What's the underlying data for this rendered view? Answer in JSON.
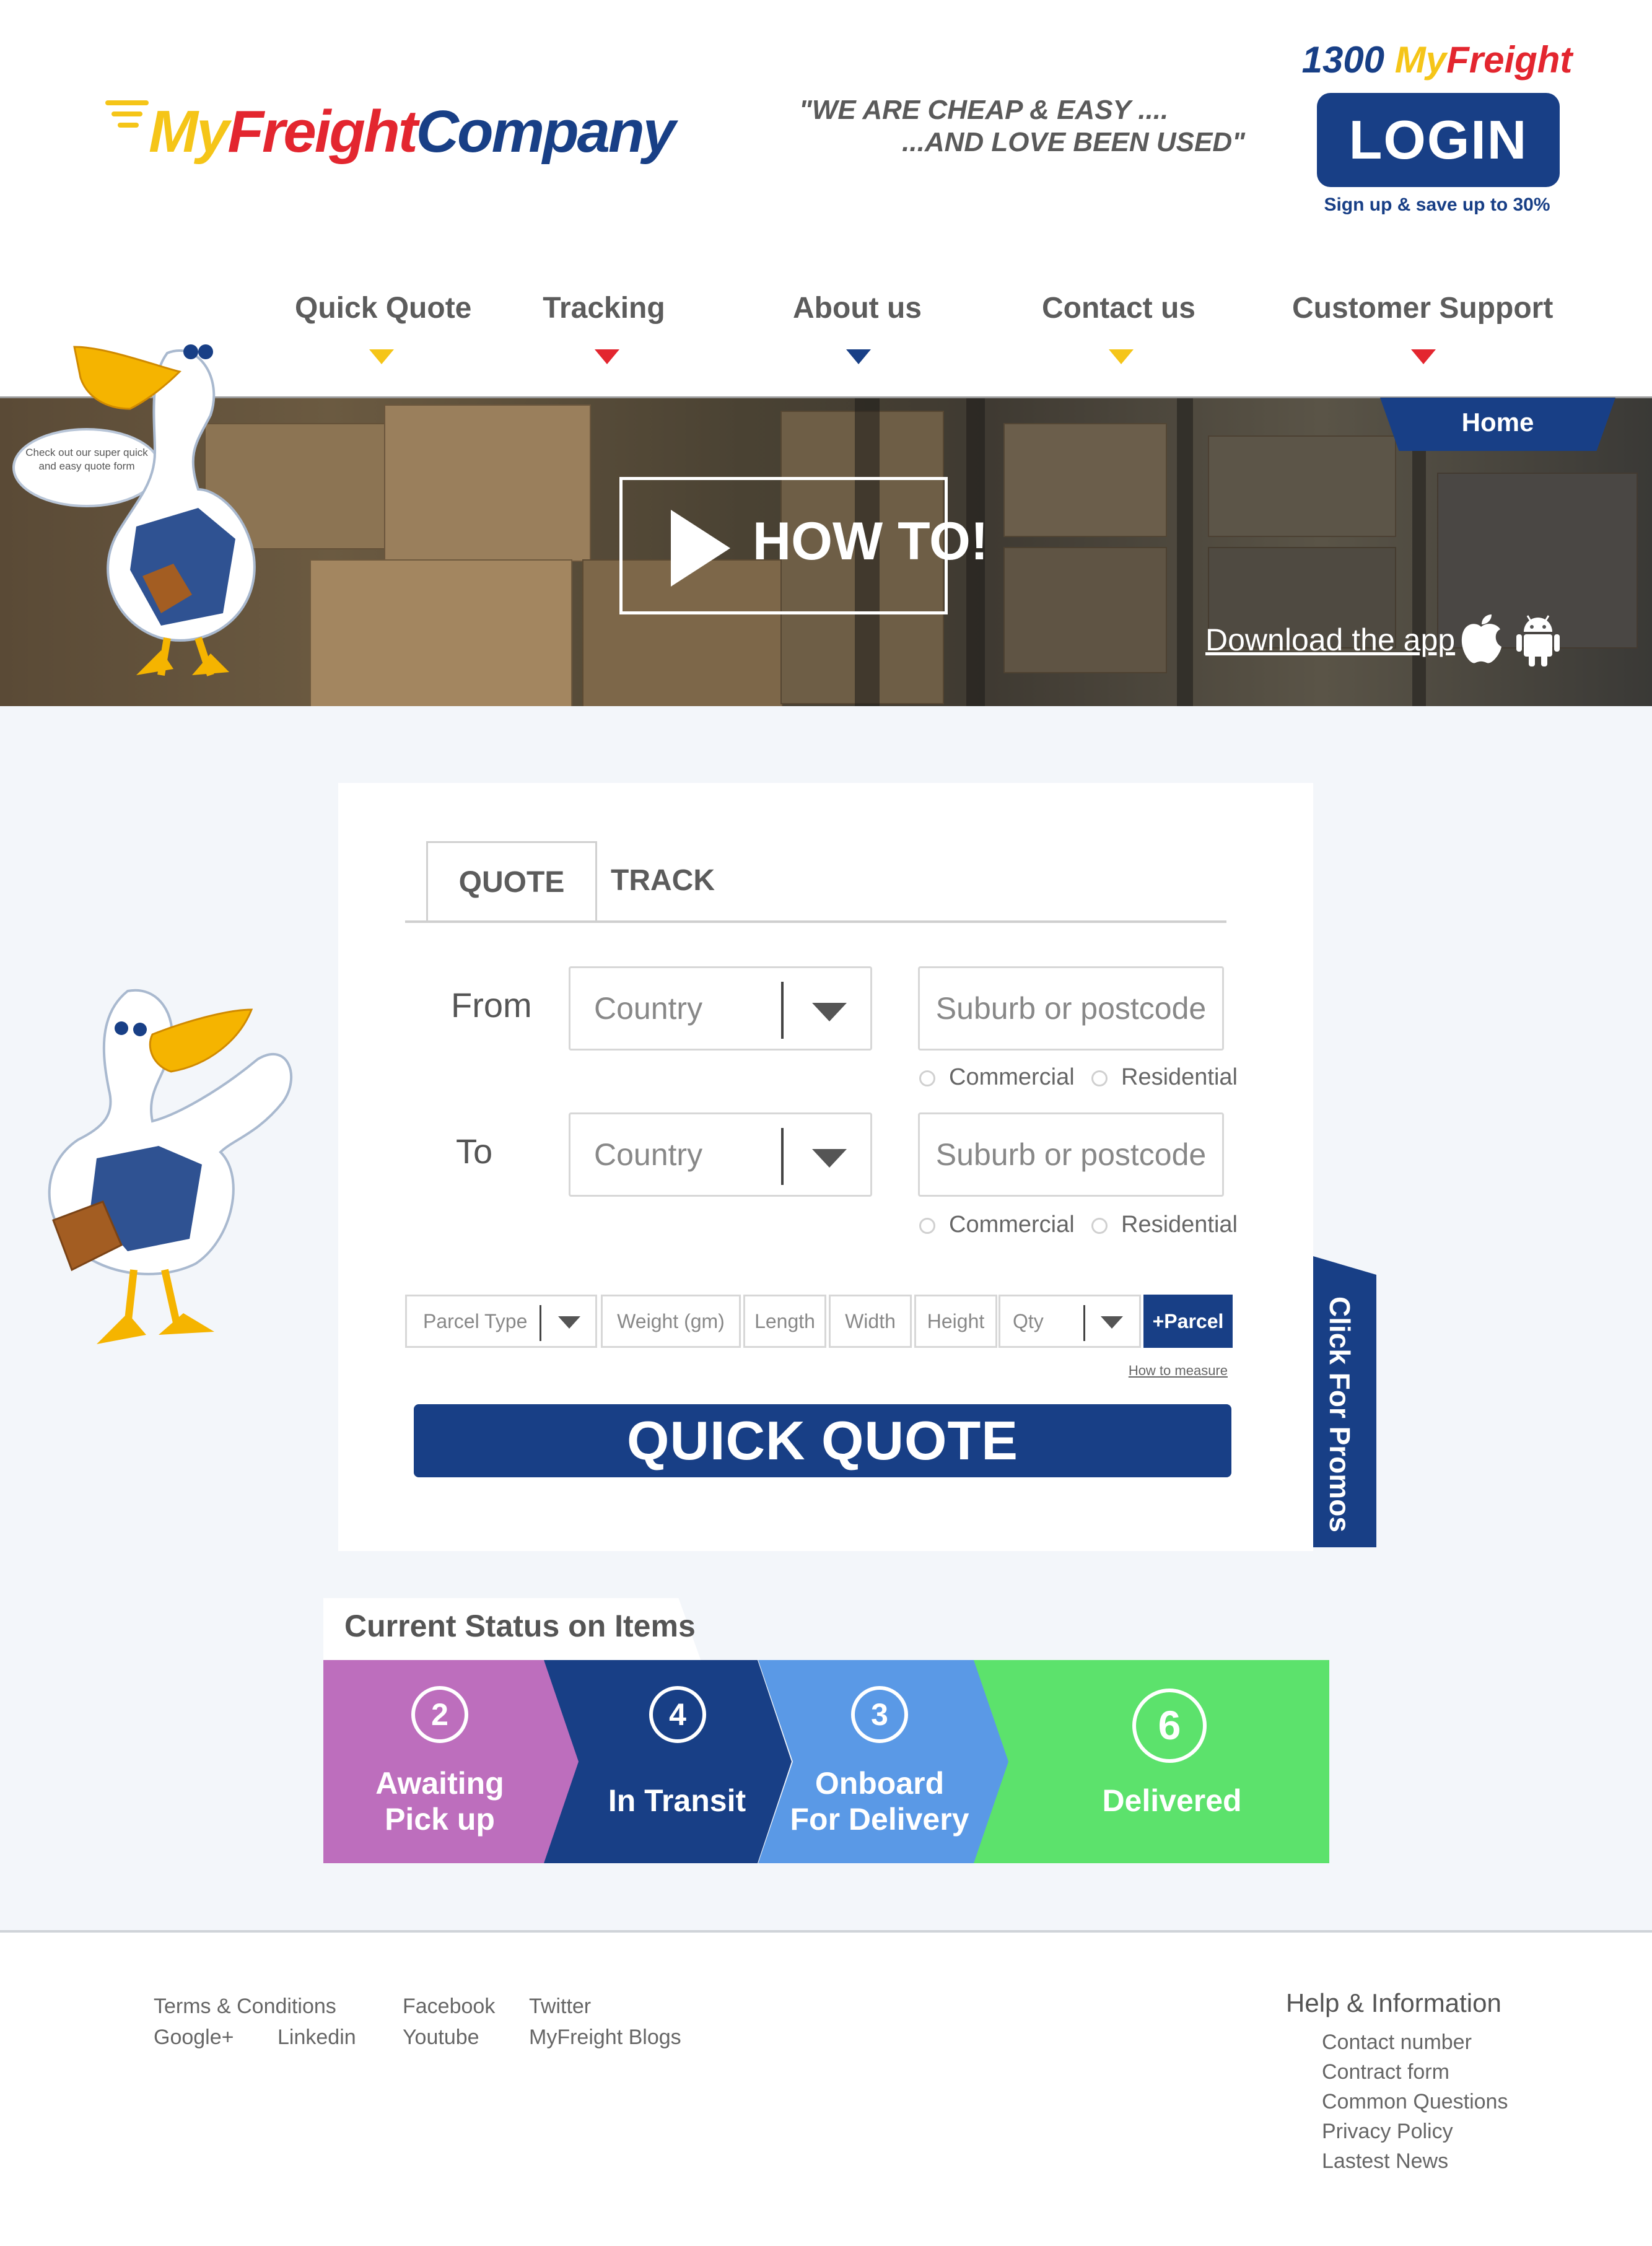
{
  "header": {
    "logo": {
      "my": "My",
      "freight": "Freight",
      "company": "Company"
    },
    "tagline_line1": "\"WE ARE CHEAP & EASY ....",
    "tagline_line2": "...AND LOVE BEEN USED\"",
    "phone_number": "1300",
    "phone_my": "My",
    "phone_freight": "Freight",
    "login_label": "LOGIN",
    "signup_text": "Sign up & save up to 30%"
  },
  "nav": {
    "items": [
      {
        "label": "Quick Quote",
        "color": "#f5c518"
      },
      {
        "label": "Tracking",
        "color": "#e3262f"
      },
      {
        "label": "About us",
        "color": "#183f86"
      },
      {
        "label": "Contact us",
        "color": "#f5c518"
      },
      {
        "label": "Customer Support",
        "color": "#e3262f"
      }
    ]
  },
  "banner": {
    "speech_bubble": "Check out our super quick and easy quote form",
    "home_tab": "Home",
    "howto_label": "HOW TO!",
    "download_label": "Download the app",
    "icons": [
      "apple-icon",
      "android-icon"
    ]
  },
  "form": {
    "tabs": [
      "QUOTE",
      "TRACK"
    ],
    "from_label": "From",
    "to_label": "To",
    "country_placeholder": "Country",
    "suburb_placeholder": "Suburb or postcode",
    "commercial_label": "Commercial",
    "residential_label": "Residential",
    "parcel": {
      "type": "Parcel Type",
      "weight": "Weight (gm)",
      "length": "Length",
      "width": "Width",
      "height": "Height",
      "qty": "Qty",
      "add_button": "+Parcel"
    },
    "how_to_measure": "How to measure",
    "quick_quote_button": "QUICK QUOTE",
    "promo_tab": "Click For Promos"
  },
  "status": {
    "title": "Current Status on Items",
    "steps": [
      {
        "count": "2",
        "line1": "Awaiting",
        "line2": "Pick up",
        "color": "#bd6ebd"
      },
      {
        "count": "4",
        "line1": "In Transit",
        "line2": "",
        "color": "#183f86"
      },
      {
        "count": "3",
        "line1": "Onboard",
        "line2": "For Delivery",
        "color": "#5a99e6"
      },
      {
        "count": "6",
        "line1": "Delivered",
        "line2": "",
        "color": "#5ce26c"
      }
    ]
  },
  "footer": {
    "links": [
      "Terms & Conditions",
      "Facebook",
      "Twitter",
      "Google+",
      "Linkedin",
      "Youtube",
      "MyFreight Blogs"
    ],
    "help_title": "Help & Information",
    "help_links": [
      "Contact number",
      "Contract form",
      "Common Questions",
      "Privacy Policy",
      "Lastest News"
    ]
  }
}
